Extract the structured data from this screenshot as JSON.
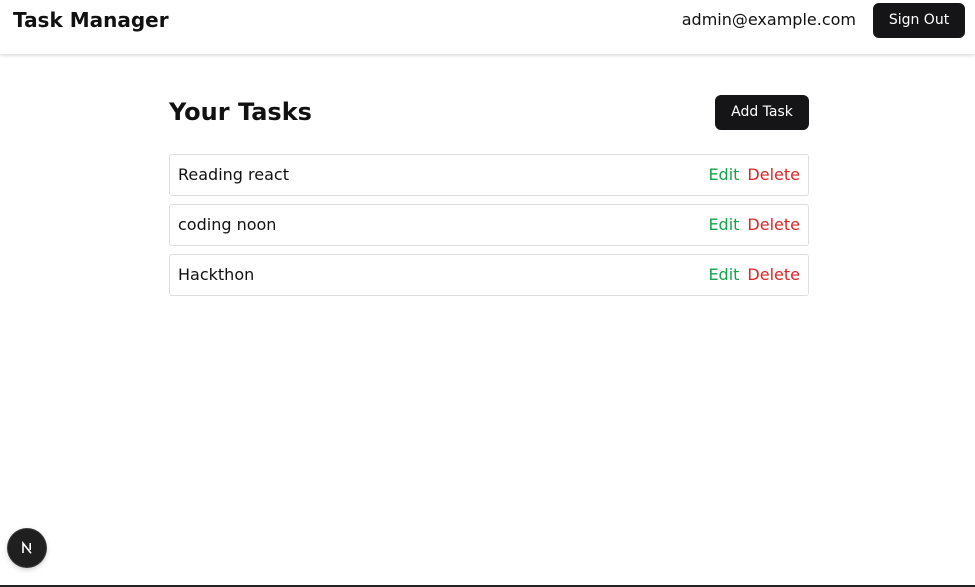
{
  "header": {
    "app_title": "Task Manager",
    "user_email": "admin@example.com",
    "signout_label": "Sign Out"
  },
  "main": {
    "section_title": "Your Tasks",
    "add_label": "Add Task",
    "tasks": [
      {
        "title": "Reading react",
        "edit_label": "Edit",
        "delete_label": "Delete"
      },
      {
        "title": "coding noon",
        "edit_label": "Edit",
        "delete_label": "Delete"
      },
      {
        "title": "Hackthon",
        "edit_label": "Edit",
        "delete_label": "Delete"
      }
    ]
  },
  "dev_badge": {
    "icon": "nextjs-logo-icon"
  },
  "colors": {
    "primary_button": "#151517",
    "edit": "#16a34a",
    "delete": "#dc2626",
    "row_border": "#dedede"
  }
}
